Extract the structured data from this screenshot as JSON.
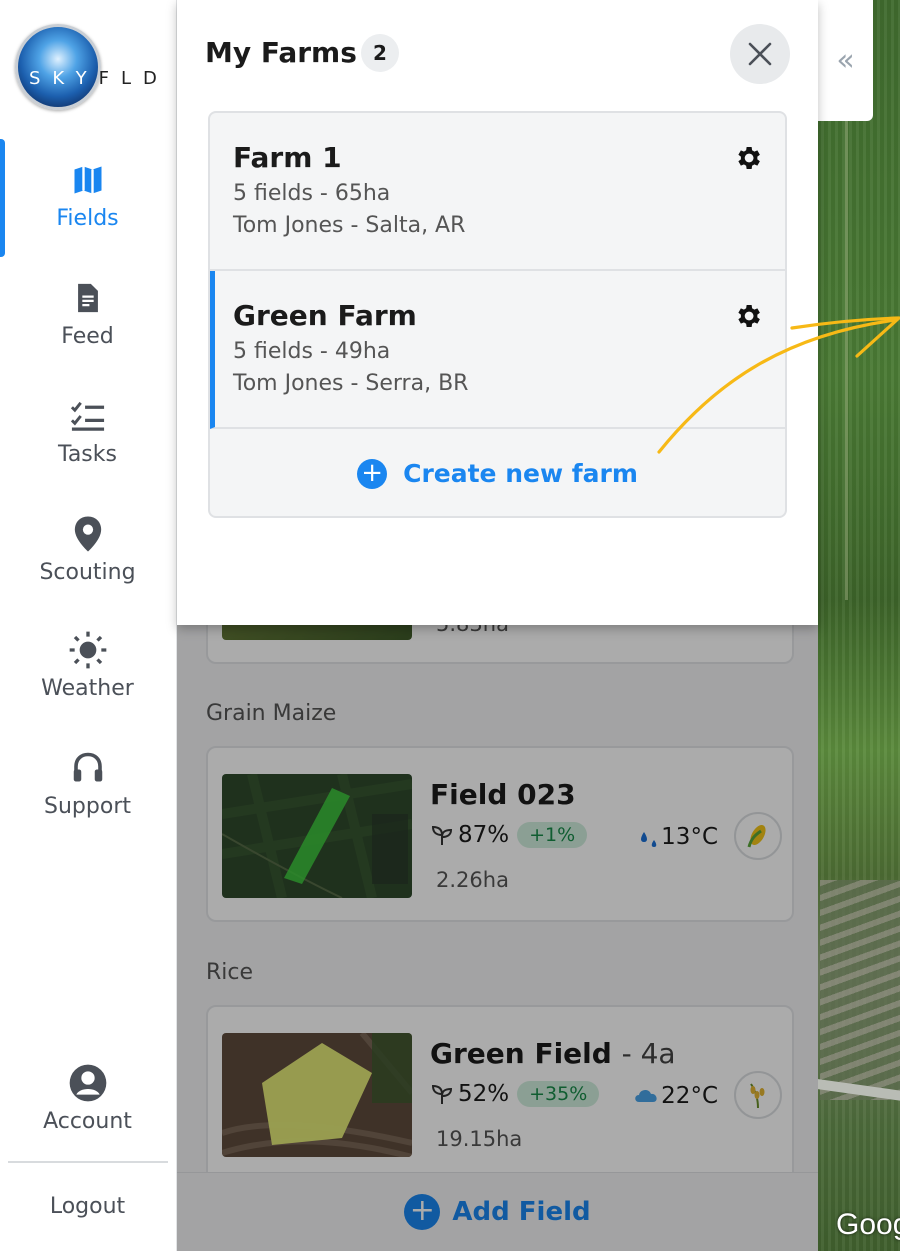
{
  "brand": {
    "logo_text": "SKYFLD",
    "logo_lead": "SKY",
    "logo_tail": "FLD",
    "accent": "#1a86f0"
  },
  "sidebar": {
    "items": [
      {
        "label": "Fields",
        "icon": "map-icon",
        "active": true
      },
      {
        "label": "Feed",
        "icon": "document-icon"
      },
      {
        "label": "Tasks",
        "icon": "checklist-icon"
      },
      {
        "label": "Scouting",
        "icon": "location-pin-icon"
      },
      {
        "label": "Weather",
        "icon": "sun-icon"
      },
      {
        "label": "Support",
        "icon": "headset-icon"
      },
      {
        "label": "Account",
        "icon": "user-circle-icon"
      }
    ],
    "logout_label": "Logout"
  },
  "collapse_glyph": "«",
  "farms_popup": {
    "title": "My Farms",
    "count": "2",
    "farms": [
      {
        "name": "Farm 1",
        "summary": "5 fields - 65ha",
        "owner_location": "Tom Jones - Salta, AR",
        "active": false
      },
      {
        "name": "Green Farm",
        "summary": "5 fields - 49ha",
        "owner_location": "Tom Jones - Serra, BR",
        "active": true
      }
    ],
    "create_label": "Create new farm",
    "create_glyph": "+"
  },
  "fields_panel": {
    "partial_area": "5.83ha",
    "groups": [
      {
        "heading": "Grain Maize",
        "field": {
          "name": "Field 023",
          "sub": "",
          "health": "87%",
          "delta": "+1%",
          "temp": "13°C",
          "area": "2.26ha",
          "weather_icon": "rain-drops-icon",
          "crop_icon": "corn-icon"
        }
      },
      {
        "heading": "Rice",
        "field": {
          "name": "Green Field",
          "sub": "- 4a",
          "health": "52%",
          "delta": "+35%",
          "temp": "22°C",
          "area": "19.15ha",
          "weather_icon": "cloud-icon",
          "crop_icon": "rice-icon"
        }
      }
    ],
    "add_label": "Add Field",
    "add_glyph": "+"
  },
  "map": {
    "attribution": "Goog"
  }
}
